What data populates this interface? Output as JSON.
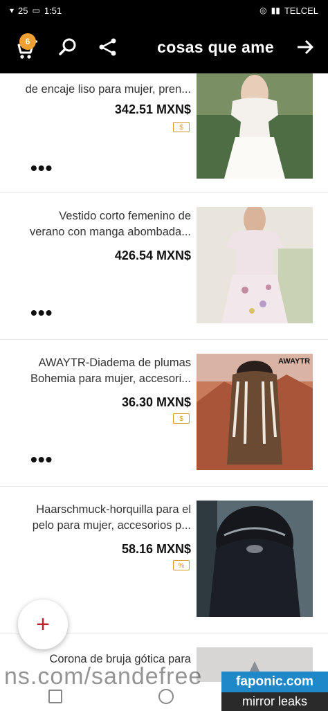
{
  "status_bar": {
    "time": "1:51",
    "battery": "25",
    "carrier": "TELCEL"
  },
  "app_bar": {
    "title": "cosas que ame",
    "cart_count": "6",
    "icons": [
      "cart-icon",
      "search-icon",
      "share-icon",
      "back-arrow-icon"
    ]
  },
  "items": [
    {
      "title_lines": [
        "de encaje liso para mujer, pren..."
      ],
      "price": "342.51 MXN$",
      "coin_label": "$",
      "more": "•••"
    },
    {
      "title_lines": [
        "Vestido corto femenino de",
        "verano con manga abombada..."
      ],
      "price": "426.54 MXN$",
      "more": "•••"
    },
    {
      "title_lines": [
        "AWAYTR-Diadema de plumas",
        "Bohemia para mujer, accesori..."
      ],
      "price": "36.30 MXN$",
      "coin_label": "$",
      "more": "•••",
      "image_label": "AWAYTR"
    },
    {
      "title_lines": [
        "Haarschmuck-horquilla para el",
        "pelo para mujer, accesorios p..."
      ],
      "price": "58.16 MXN$",
      "coin_label": "%",
      "more": "•••"
    },
    {
      "title_lines": [
        "Corona de bruja gótica para"
      ]
    }
  ],
  "fab": {
    "label": "+"
  },
  "watermark": {
    "text": "ns.com/sandefree",
    "badge_top": "faponic.com",
    "badge_bottom": "mirror leaks"
  }
}
